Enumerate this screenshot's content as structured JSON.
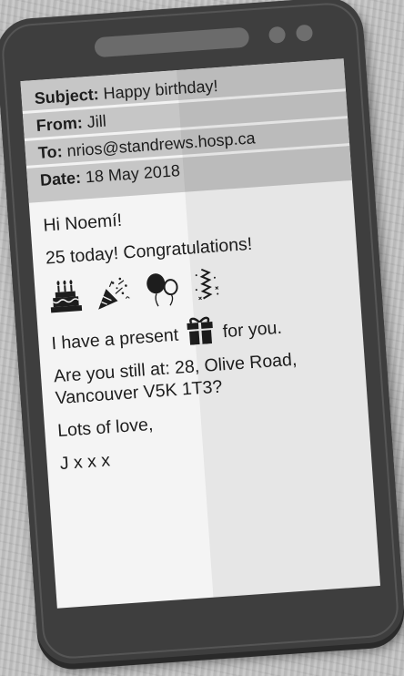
{
  "email": {
    "subject_label": "Subject:",
    "subject": "Happy birthday!",
    "from_label": "From:",
    "from": "Jill",
    "to_label": "To:",
    "to": "nrios@standrews.hosp.ca",
    "date_label": "Date:",
    "date": "18 May 2018"
  },
  "message": {
    "greeting": "Hi Noemí!",
    "line1": "25 today! Congratulations!",
    "icons": [
      "birthday-cake-icon",
      "party-popper-icon",
      "balloons-icon",
      "streamers-icon"
    ],
    "present_before": "I have a present",
    "present_after": "for you.",
    "address_line1": "Are you still at: 28, Olive Road,",
    "address_line2": "Vancouver V5K 1T3?",
    "signoff": "Lots of love,",
    "signature": "J x x x"
  }
}
